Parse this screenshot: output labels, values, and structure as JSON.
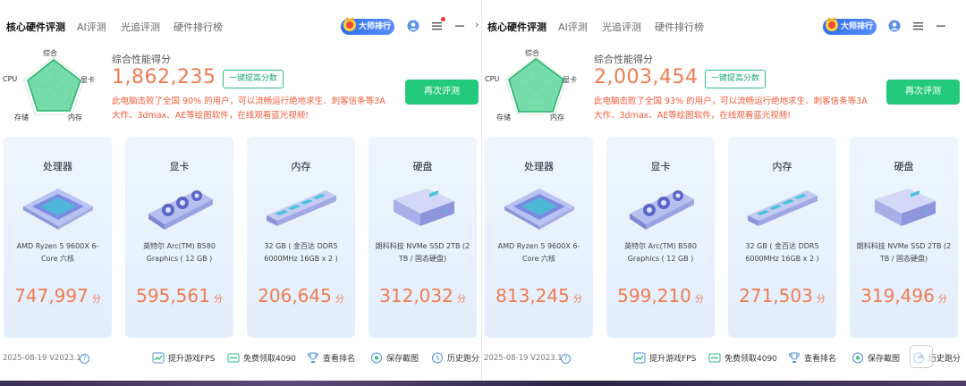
{
  "panels": [
    {
      "tabs": [
        "核心硬件评测",
        "AI评测",
        "光追评测",
        "硬件排行榜"
      ],
      "rank_badge": "大师排行",
      "radar": {
        "top": "综合",
        "right": "显卡",
        "left": "CPU",
        "bottom_left": "存储",
        "bottom_right": "内存"
      },
      "score_caption": "综合性能得分",
      "score_total": "1,862,235",
      "boost_label": "一键提高分数",
      "description": "此电脑击败了全国 90% 的用户，可以流畅运行绝地求生、刺客信条等3A大作、3dmax、AE等绘图软件，在线观看蓝光视频!",
      "retest_label": "再次评测",
      "cards": [
        {
          "title": "处理器",
          "desc": "AMD Ryzen 5 9600X 6-Core 六核",
          "score": "747,997",
          "unit": "分"
        },
        {
          "title": "显卡",
          "desc": "英特尔 Arc(TM) B580 Graphics ( 12 GB )",
          "score": "595,561",
          "unit": "分"
        },
        {
          "title": "内存",
          "desc": "32 GB ( 金百达 DDR5 6000MHz 16GB x 2 )",
          "score": "206,645",
          "unit": "分"
        },
        {
          "title": "硬盘",
          "desc": "朗科科技 NVMe SSD 2TB (2 TB / 固态硬盘)",
          "score": "312,032",
          "unit": "分"
        }
      ],
      "version": "2025-08-19 V2023.1",
      "footer": [
        "提升游戏FPS",
        "免费领取4090",
        "查看排名",
        "保存截图",
        "历史跑分"
      ]
    },
    {
      "tabs": [
        "核心硬件评测",
        "AI评测",
        "光追评测",
        "硬件排行榜"
      ],
      "rank_badge": "大师排行",
      "radar": {
        "top": "综合",
        "right": "显卡",
        "left": "CPU",
        "bottom_left": "存储",
        "bottom_right": "内存"
      },
      "score_caption": "综合性能得分",
      "score_total": "2,003,454",
      "boost_label": "一键提高分数",
      "description": "此电脑击败了全国 93% 的用户，可以流畅运行绝地求生、刺客信条等3A大作、3dmax、AE等绘图软件，在线观看蓝光视频!",
      "retest_label": "再次评测",
      "cards": [
        {
          "title": "处理器",
          "desc": "AMD Ryzen 5 9600X 6-Core 六核",
          "score": "813,245",
          "unit": "分"
        },
        {
          "title": "显卡",
          "desc": "英特尔 Arc(TM) B580 Graphics ( 12 GB )",
          "score": "599,210",
          "unit": "分"
        },
        {
          "title": "内存",
          "desc": "32 GB ( 金百达 DDR5 6000MHz 16GB x 2 )",
          "score": "271,503",
          "unit": "分"
        },
        {
          "title": "硬盘",
          "desc": "朗科科技 NVMe SSD 2TB (2 TB / 固态硬盘)",
          "score": "319,496",
          "unit": "分"
        }
      ],
      "version": "2025-08-19 V2023.1",
      "footer": [
        "提升游戏FPS",
        "免费领取4090",
        "查看排名",
        "保存截图",
        "历史跑分"
      ]
    }
  ],
  "icons": {
    "crown": "crown-icon",
    "user": "user-icon",
    "menu": "menu-icon",
    "minimize": "minimize-icon",
    "help": "help-icon",
    "fps": "fps-icon",
    "gpu_gift": "gpu-gift-icon",
    "rank": "trophy-icon",
    "save": "screenshot-icon",
    "history": "history-icon",
    "chevron": "chevron-right-icon"
  },
  "colors": {
    "accent_green": "#23c97a",
    "score_orange": "#f07b52",
    "desc_red": "#f05a3a",
    "badge_blue": "#2f6ff0",
    "card_bg": "#e8f1fc"
  }
}
